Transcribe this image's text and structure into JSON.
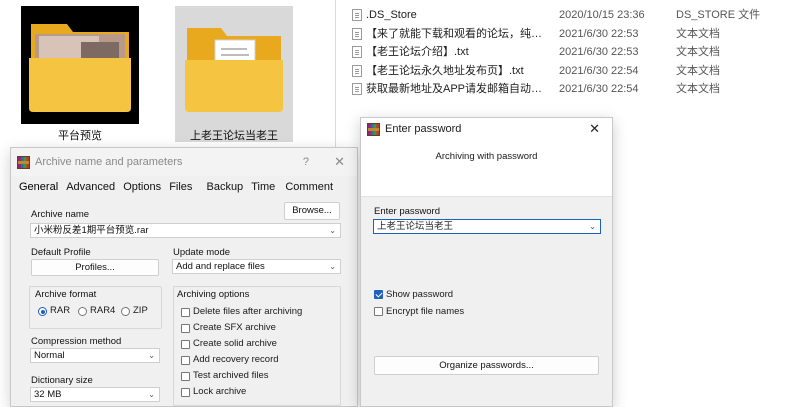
{
  "explorer": {
    "thumbs": [
      {
        "label": "平台预览",
        "selected": false
      },
      {
        "label": "上老王论坛当老王",
        "selected": true
      }
    ]
  },
  "filelist": {
    "rows": [
      {
        "name": ".DS_Store",
        "date": "2020/10/15 23:36",
        "type": "DS_STORE 文件"
      },
      {
        "name": "【来了就能下载和观看的论坛，纯免费！...",
        "date": "2021/6/30 22:53",
        "type": "文本文档"
      },
      {
        "name": "【老王论坛介绍】.txt",
        "date": "2021/6/30 22:53",
        "type": "文本文档"
      },
      {
        "name": "【老王论坛永久地址发布页】.txt",
        "date": "2021/6/30 22:54",
        "type": "文本文档"
      },
      {
        "name": "获取最新地址及APP请发邮箱自动获取.txt",
        "date": "2021/6/30 22:54",
        "type": "文本文档"
      }
    ]
  },
  "rar": {
    "title": "Archive name and parameters",
    "help": "?",
    "close": "✕",
    "tabs": [
      "General",
      "Advanced",
      "Options",
      "Files",
      "Backup",
      "Time",
      "Comment"
    ],
    "archive_name_label": "Archive name",
    "browse_label": "Browse...",
    "archive_name_value": "小米粉反差1期平台预览.rar",
    "default_profile_label": "Default Profile",
    "profiles_label": "Profiles...",
    "update_mode_label": "Update mode",
    "update_mode_value": "Add and replace files",
    "archive_format_label": "Archive format",
    "formats": [
      "RAR",
      "RAR4",
      "ZIP"
    ],
    "selected_format": "RAR",
    "compression_label": "Compression method",
    "compression_value": "Normal",
    "dictionary_label": "Dictionary size",
    "dictionary_value": "32 MB",
    "archiving_options_label": "Archiving options",
    "options": [
      {
        "label": "Delete files after archiving",
        "checked": false
      },
      {
        "label": "Create SFX archive",
        "checked": false
      },
      {
        "label": "Create solid archive",
        "checked": false
      },
      {
        "label": "Add recovery record",
        "checked": false
      },
      {
        "label": "Test archived files",
        "checked": false
      },
      {
        "label": "Lock archive",
        "checked": false
      }
    ]
  },
  "pwd": {
    "title": "Enter password",
    "close": "✕",
    "subtitle": "Archiving with password",
    "enter_label": "Enter password",
    "password_value": "上老王论坛当老王",
    "show_password_label": "Show password",
    "show_password_checked": true,
    "encrypt_names_label": "Encrypt file names",
    "encrypt_names_checked": false,
    "organize_label": "Organize passwords..."
  },
  "colors": {
    "accent": "#1f5fbf",
    "folder": "#f5c542",
    "folder_back": "#e9a91f"
  }
}
